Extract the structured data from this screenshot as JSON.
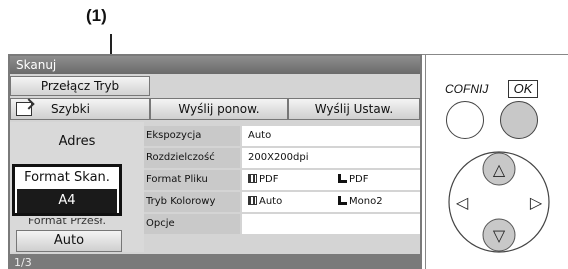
{
  "callout": {
    "label": "(1)"
  },
  "window": {
    "title": "Skanuj"
  },
  "buttons": {
    "mode": "Przełącz Tryb",
    "quick": "Szybki",
    "resend": "Wyślij ponow.",
    "send_settings": "Wyślij Ustaw."
  },
  "left": {
    "address": "Adres",
    "scan_format_label": "Format Skan.",
    "scan_format_value": "A4",
    "send_format_label": "Format Przesł.",
    "send_format_value": "Auto"
  },
  "settings": {
    "exposure_label": "Ekspozycja",
    "exposure_value": "Auto",
    "resolution_label": "Rozdzielczość",
    "resolution_value": "200X200dpi",
    "file_format_label": "Format Pliku",
    "file_format_value_1": "PDF",
    "file_format_value_2": "PDF",
    "color_mode_label": "Tryb Kolorowy",
    "color_mode_value_1": "Auto",
    "color_mode_value_2": "Mono2",
    "options_label": "Opcje"
  },
  "pager": {
    "text": "1/3"
  },
  "keys": {
    "back_label": "COFNIJ",
    "ok_label": "OK"
  },
  "dpad": {
    "up": "△",
    "down": "▽",
    "left": "◁",
    "right": "▷"
  },
  "colors": {
    "titlebar": "#7a7a7a",
    "selected": "#1a1a1a",
    "ok_button": "#c8c8c8"
  },
  "icons": [
    "quick-scan-icon",
    "grid-doc-icon",
    "multi-page-icon"
  ]
}
